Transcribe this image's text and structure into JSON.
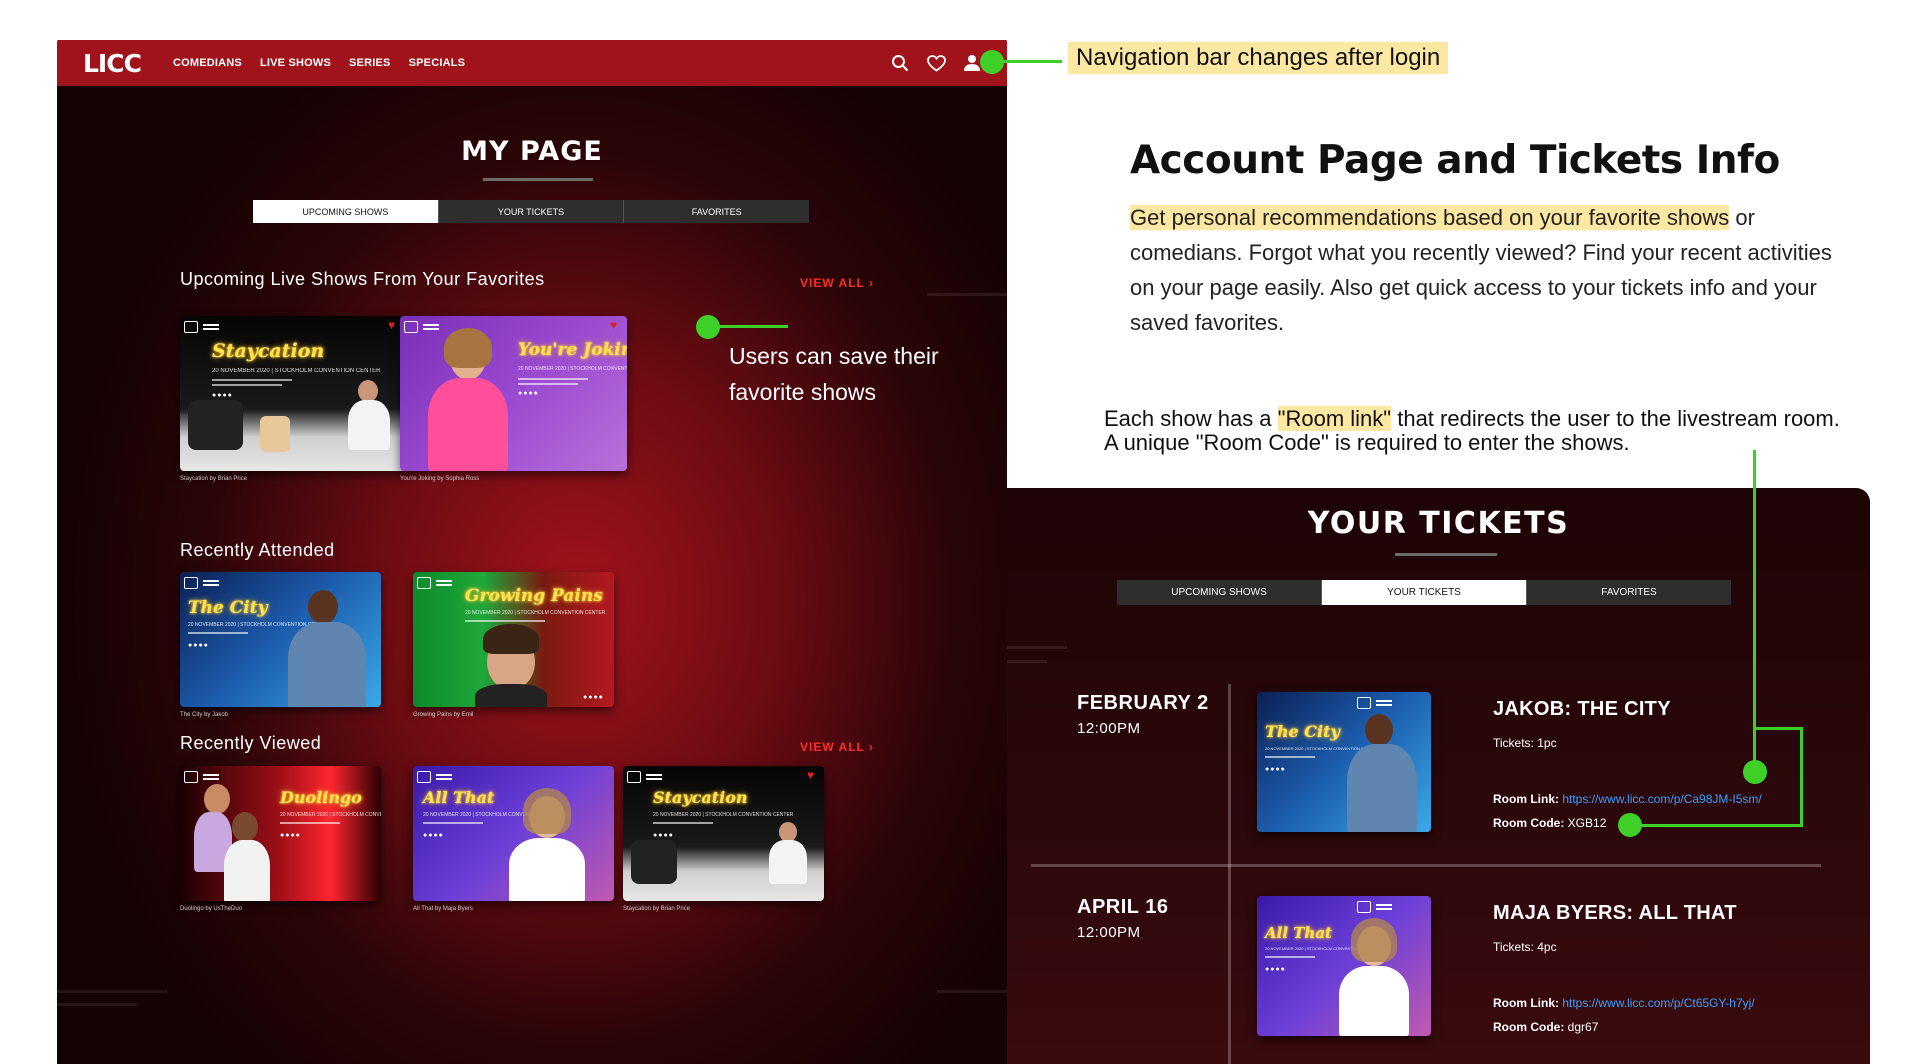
{
  "annotations": {
    "nav_note": "Navigation bar changes after login",
    "heading": "Account Page and Tickets Info",
    "para_highlight": "Get personal recommendations based on your favorite shows",
    "para_rest": " or comedians. Forgot what you recently viewed? Find your recent activities on your page easily. Also get quick access to your tickets info and your saved favorites.",
    "room_pre": "Each show has a ",
    "room_highlight": "\"Room link\"",
    "room_post": " that redirects the user to the livestream room. A unique \"Room Code\" is required to enter the shows.",
    "save_note": "Users can save their favorite shows"
  },
  "nav": {
    "logo": "LICC",
    "links": [
      "COMEDIANS",
      "LIVE SHOWS",
      "SERIES",
      "SPECIALS"
    ]
  },
  "my_page": {
    "title": "MY PAGE",
    "tabs": [
      "UPCOMING SHOWS",
      "YOUR TICKETS",
      "FAVORITES"
    ],
    "upcoming_title": "Upcoming Live Shows From Your Favorites",
    "view_all": "VIEW ALL ›",
    "recently_attended_title": "Recently Attended",
    "recently_viewed_title": "Recently Viewed",
    "card_subline": "20 NOVEMBER 2020 | STOCKHOLM CONVENTION CENTER",
    "cards": [
      {
        "title": "Staycation",
        "caption": "Staycation by Brian Price"
      },
      {
        "title": "You're Joking",
        "caption": "You're Joking by Sophia Ross"
      },
      {
        "title": "The City",
        "caption": "The City by Jakob"
      },
      {
        "title": "Growing Pains",
        "caption": "Growing Pains by Emil"
      },
      {
        "title": "Duolingo",
        "caption": "Duolingo by UsTheDuo"
      },
      {
        "title": "All That",
        "caption": "All That by Maja Byers"
      },
      {
        "title": "Staycation",
        "caption": "Staycation by Brian Price"
      }
    ],
    "dots": "●●●●"
  },
  "tickets": {
    "title": "YOUR TICKETS",
    "tabs": [
      "UPCOMING SHOWS",
      "YOUR TICKETS",
      "FAVORITES"
    ],
    "items": [
      {
        "date": "FEBRUARY 2",
        "time": "12:00PM",
        "name": "JAKOB: THE CITY",
        "tickets": "Tickets: 1pc",
        "link_label": "Room Link:",
        "link": "https://www.licc.com/p/Ca98JM-I5sm/",
        "code_label": "Room Code:",
        "code": "XGB12",
        "card_title": "The City"
      },
      {
        "date": "APRIL 16",
        "time": "12:00PM",
        "name": "MAJA BYERS: ALL THAT",
        "tickets": "Tickets: 4pc",
        "link_label": "Room Link:",
        "link": "https://www.licc.com/p/Ct65GY-h7yj/",
        "code_label": "Room Code:",
        "code": "dgr67",
        "card_title": "All That"
      }
    ]
  },
  "colors": {
    "brand_red": "#a0131b",
    "accent_green": "#3fcf29",
    "highlight": "#fde8a3",
    "link_blue": "#3aa0ff"
  }
}
